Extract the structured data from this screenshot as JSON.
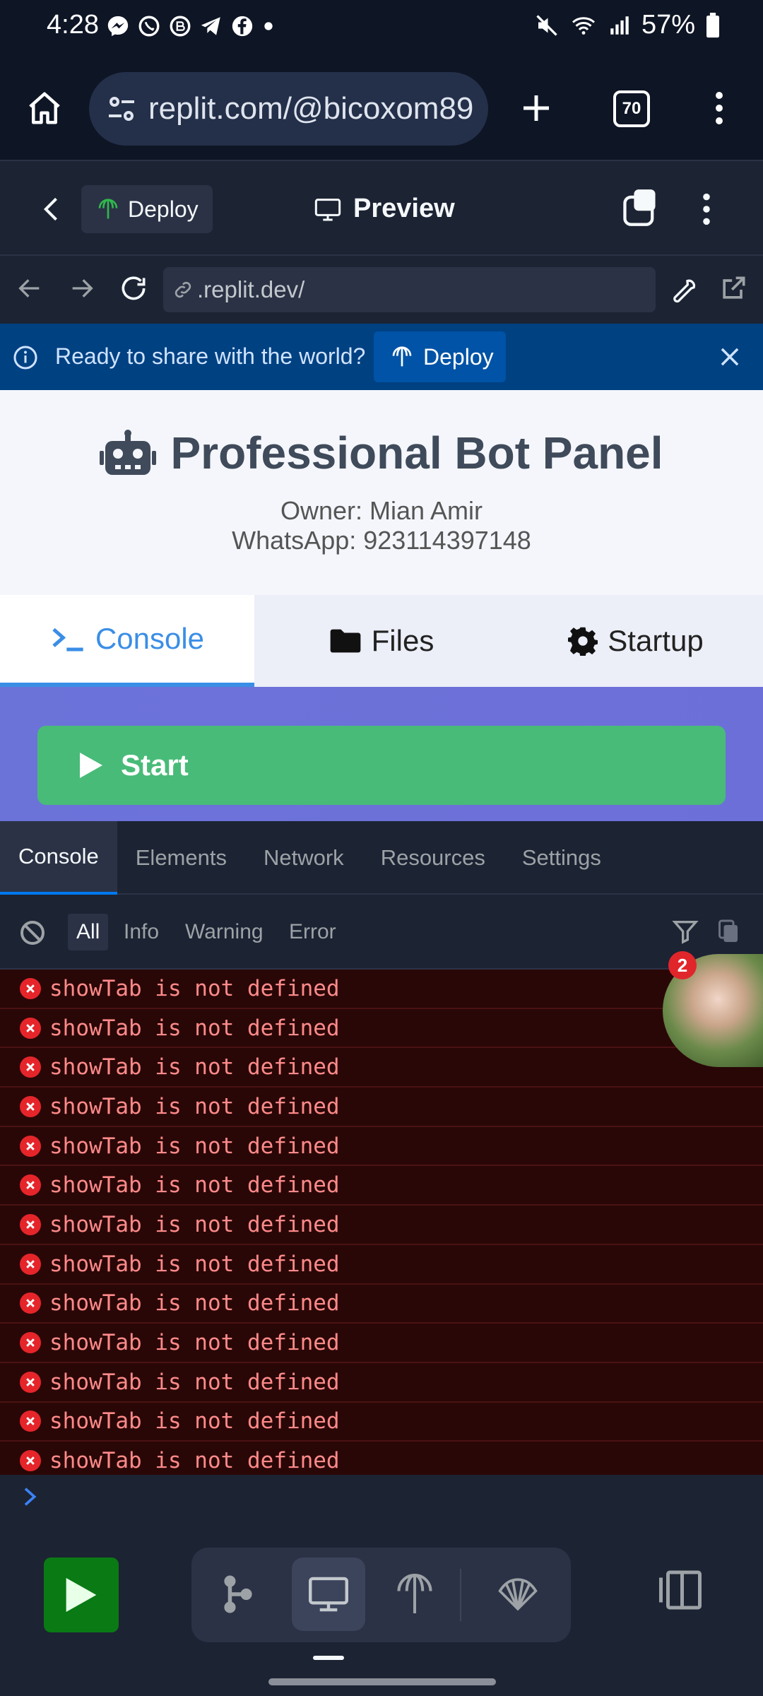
{
  "status_bar": {
    "time": "4:28",
    "battery": "57%"
  },
  "browser": {
    "url": "replit.com/@bicoxom89",
    "tab_count": "70"
  },
  "replit_header": {
    "deploy_label": "Deploy",
    "preview_label": "Preview"
  },
  "inner_browser": {
    "url": ".replit.dev/"
  },
  "banner": {
    "text": "Ready to share with the world?",
    "deploy_label": "Deploy"
  },
  "page": {
    "title": "Professional Bot Panel",
    "owner": "Owner: Mian Amir",
    "whatsapp": "WhatsApp: 923114397148",
    "tabs": [
      {
        "label": "Console",
        "active": true
      },
      {
        "label": "Files",
        "active": false
      },
      {
        "label": "Startup",
        "active": false
      }
    ],
    "start_label": "Start"
  },
  "devtools": {
    "tabs": [
      "Console",
      "Elements",
      "Network",
      "Resources",
      "Settings"
    ],
    "filters": [
      "All",
      "Info",
      "Warning",
      "Error"
    ],
    "active_filter": "All",
    "log_message": "showTab is not defined",
    "logs": [
      "showTab is not defined",
      "showTab is not defined",
      "showTab is not defined",
      "showTab is not defined",
      "showTab is not defined",
      "showTab is not defined",
      "showTab is not defined",
      "showTab is not defined",
      "showTab is not defined",
      "showTab is not defined",
      "showTab is not defined",
      "showTab is not defined",
      "showTab is not defined"
    ]
  },
  "avatar_badge": "2",
  "colors": {
    "accent": "#3a8ee6",
    "start_green": "#48bb78",
    "error_bg": "#2a0707",
    "error_text": "#ff8a8a",
    "banner_bg": "#004182"
  }
}
